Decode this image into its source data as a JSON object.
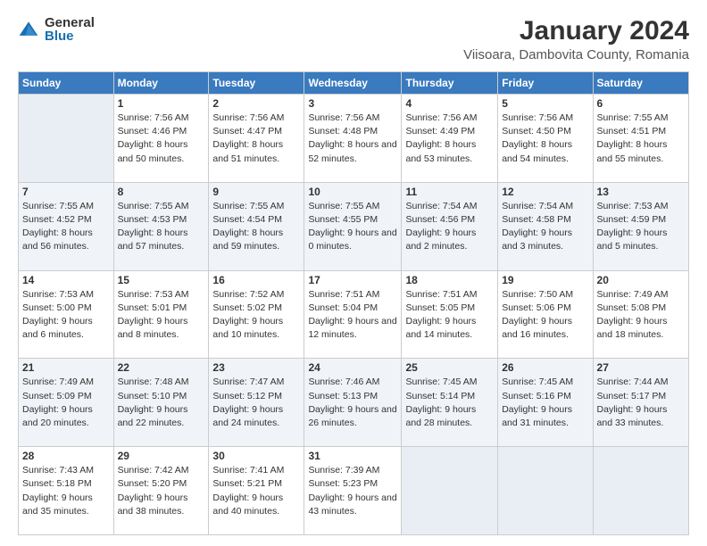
{
  "header": {
    "logo_general": "General",
    "logo_blue": "Blue",
    "month_title": "January 2024",
    "location": "Viisoara, Dambovita County, Romania"
  },
  "weekdays": [
    "Sunday",
    "Monday",
    "Tuesday",
    "Wednesday",
    "Thursday",
    "Friday",
    "Saturday"
  ],
  "weeks": [
    [
      {
        "num": "",
        "sunrise": "",
        "sunset": "",
        "daylight": ""
      },
      {
        "num": "1",
        "sunrise": "Sunrise: 7:56 AM",
        "sunset": "Sunset: 4:46 PM",
        "daylight": "Daylight: 8 hours and 50 minutes."
      },
      {
        "num": "2",
        "sunrise": "Sunrise: 7:56 AM",
        "sunset": "Sunset: 4:47 PM",
        "daylight": "Daylight: 8 hours and 51 minutes."
      },
      {
        "num": "3",
        "sunrise": "Sunrise: 7:56 AM",
        "sunset": "Sunset: 4:48 PM",
        "daylight": "Daylight: 8 hours and 52 minutes."
      },
      {
        "num": "4",
        "sunrise": "Sunrise: 7:56 AM",
        "sunset": "Sunset: 4:49 PM",
        "daylight": "Daylight: 8 hours and 53 minutes."
      },
      {
        "num": "5",
        "sunrise": "Sunrise: 7:56 AM",
        "sunset": "Sunset: 4:50 PM",
        "daylight": "Daylight: 8 hours and 54 minutes."
      },
      {
        "num": "6",
        "sunrise": "Sunrise: 7:55 AM",
        "sunset": "Sunset: 4:51 PM",
        "daylight": "Daylight: 8 hours and 55 minutes."
      }
    ],
    [
      {
        "num": "7",
        "sunrise": "Sunrise: 7:55 AM",
        "sunset": "Sunset: 4:52 PM",
        "daylight": "Daylight: 8 hours and 56 minutes."
      },
      {
        "num": "8",
        "sunrise": "Sunrise: 7:55 AM",
        "sunset": "Sunset: 4:53 PM",
        "daylight": "Daylight: 8 hours and 57 minutes."
      },
      {
        "num": "9",
        "sunrise": "Sunrise: 7:55 AM",
        "sunset": "Sunset: 4:54 PM",
        "daylight": "Daylight: 8 hours and 59 minutes."
      },
      {
        "num": "10",
        "sunrise": "Sunrise: 7:55 AM",
        "sunset": "Sunset: 4:55 PM",
        "daylight": "Daylight: 9 hours and 0 minutes."
      },
      {
        "num": "11",
        "sunrise": "Sunrise: 7:54 AM",
        "sunset": "Sunset: 4:56 PM",
        "daylight": "Daylight: 9 hours and 2 minutes."
      },
      {
        "num": "12",
        "sunrise": "Sunrise: 7:54 AM",
        "sunset": "Sunset: 4:58 PM",
        "daylight": "Daylight: 9 hours and 3 minutes."
      },
      {
        "num": "13",
        "sunrise": "Sunrise: 7:53 AM",
        "sunset": "Sunset: 4:59 PM",
        "daylight": "Daylight: 9 hours and 5 minutes."
      }
    ],
    [
      {
        "num": "14",
        "sunrise": "Sunrise: 7:53 AM",
        "sunset": "Sunset: 5:00 PM",
        "daylight": "Daylight: 9 hours and 6 minutes."
      },
      {
        "num": "15",
        "sunrise": "Sunrise: 7:53 AM",
        "sunset": "Sunset: 5:01 PM",
        "daylight": "Daylight: 9 hours and 8 minutes."
      },
      {
        "num": "16",
        "sunrise": "Sunrise: 7:52 AM",
        "sunset": "Sunset: 5:02 PM",
        "daylight": "Daylight: 9 hours and 10 minutes."
      },
      {
        "num": "17",
        "sunrise": "Sunrise: 7:51 AM",
        "sunset": "Sunset: 5:04 PM",
        "daylight": "Daylight: 9 hours and 12 minutes."
      },
      {
        "num": "18",
        "sunrise": "Sunrise: 7:51 AM",
        "sunset": "Sunset: 5:05 PM",
        "daylight": "Daylight: 9 hours and 14 minutes."
      },
      {
        "num": "19",
        "sunrise": "Sunrise: 7:50 AM",
        "sunset": "Sunset: 5:06 PM",
        "daylight": "Daylight: 9 hours and 16 minutes."
      },
      {
        "num": "20",
        "sunrise": "Sunrise: 7:49 AM",
        "sunset": "Sunset: 5:08 PM",
        "daylight": "Daylight: 9 hours and 18 minutes."
      }
    ],
    [
      {
        "num": "21",
        "sunrise": "Sunrise: 7:49 AM",
        "sunset": "Sunset: 5:09 PM",
        "daylight": "Daylight: 9 hours and 20 minutes."
      },
      {
        "num": "22",
        "sunrise": "Sunrise: 7:48 AM",
        "sunset": "Sunset: 5:10 PM",
        "daylight": "Daylight: 9 hours and 22 minutes."
      },
      {
        "num": "23",
        "sunrise": "Sunrise: 7:47 AM",
        "sunset": "Sunset: 5:12 PM",
        "daylight": "Daylight: 9 hours and 24 minutes."
      },
      {
        "num": "24",
        "sunrise": "Sunrise: 7:46 AM",
        "sunset": "Sunset: 5:13 PM",
        "daylight": "Daylight: 9 hours and 26 minutes."
      },
      {
        "num": "25",
        "sunrise": "Sunrise: 7:45 AM",
        "sunset": "Sunset: 5:14 PM",
        "daylight": "Daylight: 9 hours and 28 minutes."
      },
      {
        "num": "26",
        "sunrise": "Sunrise: 7:45 AM",
        "sunset": "Sunset: 5:16 PM",
        "daylight": "Daylight: 9 hours and 31 minutes."
      },
      {
        "num": "27",
        "sunrise": "Sunrise: 7:44 AM",
        "sunset": "Sunset: 5:17 PM",
        "daylight": "Daylight: 9 hours and 33 minutes."
      }
    ],
    [
      {
        "num": "28",
        "sunrise": "Sunrise: 7:43 AM",
        "sunset": "Sunset: 5:18 PM",
        "daylight": "Daylight: 9 hours and 35 minutes."
      },
      {
        "num": "29",
        "sunrise": "Sunrise: 7:42 AM",
        "sunset": "Sunset: 5:20 PM",
        "daylight": "Daylight: 9 hours and 38 minutes."
      },
      {
        "num": "30",
        "sunrise": "Sunrise: 7:41 AM",
        "sunset": "Sunset: 5:21 PM",
        "daylight": "Daylight: 9 hours and 40 minutes."
      },
      {
        "num": "31",
        "sunrise": "Sunrise: 7:39 AM",
        "sunset": "Sunset: 5:23 PM",
        "daylight": "Daylight: 9 hours and 43 minutes."
      },
      {
        "num": "",
        "sunrise": "",
        "sunset": "",
        "daylight": ""
      },
      {
        "num": "",
        "sunrise": "",
        "sunset": "",
        "daylight": ""
      },
      {
        "num": "",
        "sunrise": "",
        "sunset": "",
        "daylight": ""
      }
    ]
  ]
}
